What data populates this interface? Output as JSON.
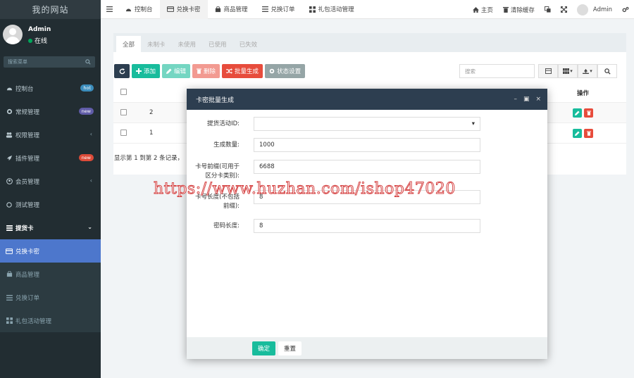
{
  "brand": "我的网站",
  "user": {
    "name": "Admin",
    "status": "在线"
  },
  "sidebar": {
    "search_placeholder": "搜索菜单",
    "items": [
      {
        "label": "控制台",
        "badge": "hot",
        "badge_color": "#3c8dbc"
      },
      {
        "label": "常规管理",
        "badge": "new",
        "badge_color": "#605ca8"
      },
      {
        "label": "权限管理",
        "chevron": "‹"
      },
      {
        "label": "插件管理",
        "badge": "new",
        "badge_color": "#dd4b39"
      },
      {
        "label": "会员管理",
        "chevron": "‹"
      },
      {
        "label": "测试管理"
      },
      {
        "label": "提货卡",
        "chevron": "⌄"
      },
      {
        "label": "兑换卡密"
      },
      {
        "label": "商品管理"
      },
      {
        "label": "兑换订单"
      },
      {
        "label": "礼包活动管理"
      }
    ]
  },
  "topnav": {
    "tabs": [
      "控制台",
      "兑换卡密",
      "商品管理",
      "兑换订单",
      "礼包活动管理"
    ],
    "right": {
      "home": "主页",
      "clear_cache": "清除缓存",
      "admin": "Admin"
    }
  },
  "content": {
    "subtabs": [
      "全部",
      "未制卡",
      "未使用",
      "已使用",
      "已失效"
    ],
    "toolbar": {
      "add": "添加",
      "edit": "编辑",
      "delete": "删除",
      "batch": "批量生成",
      "status": "状态设置"
    },
    "search_placeholder": "搜索",
    "table": {
      "ops_header": "操作",
      "rows": [
        {
          "id": "2"
        },
        {
          "id": "1"
        }
      ]
    },
    "pagination": "显示第 1 到第 2 条记录，"
  },
  "modal": {
    "title": "卡密批量生成",
    "fields": [
      {
        "label": "提货活动ID:",
        "value": ""
      },
      {
        "label": "生成数量:",
        "value": "1000"
      },
      {
        "label": "卡号前缀(可用于区分卡类别):",
        "value": "6688"
      },
      {
        "label": "卡号长度(不包括前缀):",
        "value": "8"
      },
      {
        "label": "密码长度:",
        "value": "8"
      }
    ],
    "ok": "确定",
    "reset": "重置"
  },
  "watermark": "https://www.huzhan.com/ishop47020",
  "colors": {
    "sidebar": "#222d32",
    "active": "#4d77cc",
    "header": "#2d3e50",
    "success": "#18bc9c",
    "danger": "#e74c3c"
  }
}
